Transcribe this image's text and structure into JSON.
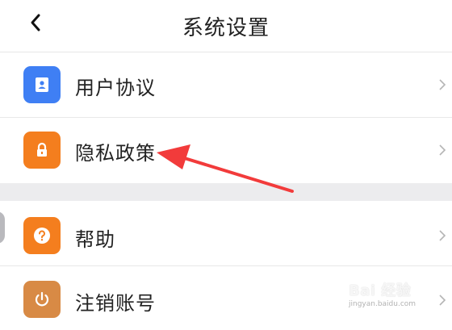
{
  "header": {
    "title": "系统设置",
    "back_icon": "chevron-left-icon"
  },
  "groups": [
    {
      "items": [
        {
          "label": "用户协议",
          "icon": "user-document-icon",
          "icon_color": "#3f7ff4"
        },
        {
          "label": "隐私政策",
          "icon": "lock-icon",
          "icon_color": "#f47e1e"
        }
      ]
    },
    {
      "items": [
        {
          "label": "帮助",
          "icon": "question-icon",
          "icon_color": "#f47e1e"
        },
        {
          "label": "注销账号",
          "icon": "power-icon",
          "icon_color": "#d88a45"
        }
      ]
    }
  ],
  "annotation": {
    "arrow_color": "#f23b3b"
  },
  "watermark": {
    "text": "Bai 经验",
    "subtext": "jingyan.baidu.com"
  },
  "colors": {
    "background": "#ececee",
    "card": "#ffffff",
    "divider": "#e8e8e8",
    "chevron": "#b5b5b5"
  }
}
